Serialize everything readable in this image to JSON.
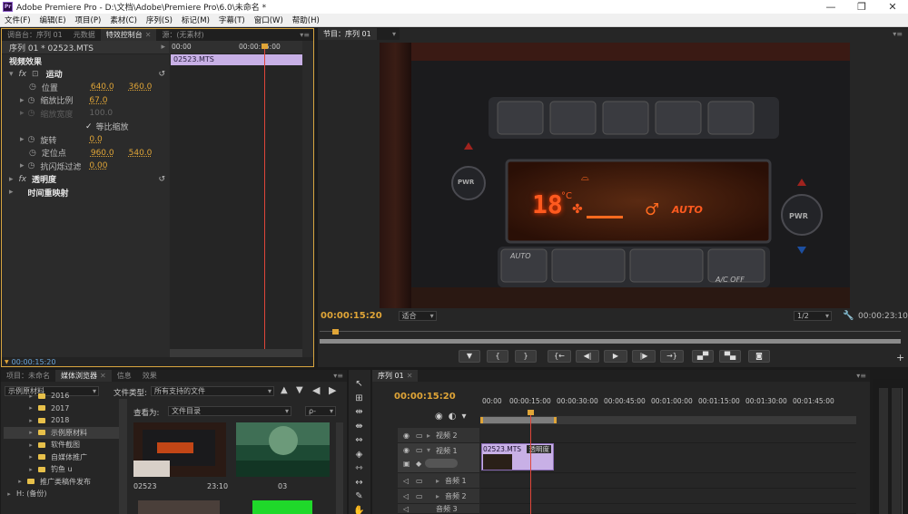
{
  "app": {
    "icon_text": "Pr",
    "title": "Adobe Premiere Pro - D:\\文档\\Adobe\\Premiere Pro\\6.0\\未命名 *",
    "window_buttons": [
      "—",
      "❐",
      "✕"
    ]
  },
  "menu": [
    "文件(F)",
    "编辑(E)",
    "项目(P)",
    "素材(C)",
    "序列(S)",
    "标记(M)",
    "字幕(T)",
    "窗口(W)",
    "帮助(H)"
  ],
  "source_panel": {
    "tabs": [
      "调音台：序列 01",
      "元数据",
      "特效控制台",
      "源：(无素材)"
    ],
    "active_tab": 2
  },
  "effect_controls": {
    "header": "序列 01 * 02523.MTS",
    "section_title": "视频效果",
    "motion_label": "运动",
    "rows": [
      {
        "label": "位置",
        "v1": "640.0",
        "v2": "360.0"
      },
      {
        "label": "缩放比例",
        "v1": "67.0",
        "v2": ""
      },
      {
        "label": "缩放宽度",
        "v1": "100.0",
        "v2": "",
        "disabled": true
      },
      {
        "label": "等比缩放",
        "checkbox": true
      },
      {
        "label": "旋转",
        "v1": "0.0",
        "v2": ""
      },
      {
        "label": "定位点",
        "v1": "960.0",
        "v2": "540.0"
      },
      {
        "label": "抗闪烁过滤",
        "v1": "0.00",
        "v2": ""
      }
    ],
    "opacity_label": "透明度",
    "time_remap_label": "时间重映射",
    "ruler_left": "00:00",
    "ruler_right": "00:00:15:00",
    "clip_name": "02523.MTS",
    "current_time": "00:00:15:20"
  },
  "program": {
    "tab": "节目：序列 01",
    "timecode": "00:00:15:20",
    "fit": "适合",
    "resolution": "1/2",
    "duration": "00:00:23:10",
    "lcd": {
      "temp": "18",
      "unit": "°C",
      "mode": "AUTO"
    },
    "buttons": {
      "pwr": "PWR",
      "auto": "AUTO",
      "ac_off": "A/C OFF"
    },
    "transport": [
      "▼",
      "{",
      "}",
      "{←",
      "◀|",
      "▶",
      "|▶",
      "→}",
      "▄▀",
      "▀▄",
      "◙"
    ]
  },
  "media": {
    "tabs": [
      "项目：未命名",
      "媒体浏览器",
      "信息",
      "效果"
    ],
    "active_tab": 1,
    "location": "示例原材料",
    "file_type_label": "文件类型:",
    "file_type_value": "所有支持的文件",
    "view_label": "查看为:",
    "view_value": "文件目录",
    "search_placeholder": "ρ-",
    "tree": [
      {
        "name": "2016",
        "indent": 1
      },
      {
        "name": "2017",
        "indent": 1
      },
      {
        "name": "2018",
        "indent": 1
      },
      {
        "name": "示例原材料",
        "indent": 1,
        "selected": true
      },
      {
        "name": "软件截图",
        "indent": 1
      },
      {
        "name": "自媒体推广",
        "indent": 1
      },
      {
        "name": "钓鱼 u",
        "indent": 1
      },
      {
        "name": "推广类稿件发布",
        "indent": 0
      },
      {
        "name": "H: (备份)",
        "indent": 0
      }
    ],
    "thumbs": [
      {
        "name": "02523",
        "duration": "23:10"
      },
      {
        "name": "03",
        "duration": ""
      }
    ]
  },
  "timeline": {
    "tab": "序列 01",
    "timecode": "00:00:15:20",
    "ruler": [
      "00:00",
      "00:00:15:00",
      "00:00:30:00",
      "00:00:45:00",
      "00:01:00:00",
      "00:01:15:00",
      "00:01:30:00",
      "00:01:45:00"
    ],
    "tracks": {
      "v2": "视频 2",
      "v1": "视频 1",
      "a1": "音频 1",
      "a2": "音频 2",
      "a3": "音频 3"
    },
    "clip": {
      "name": "02523.MTS",
      "fx": "透明度"
    }
  }
}
